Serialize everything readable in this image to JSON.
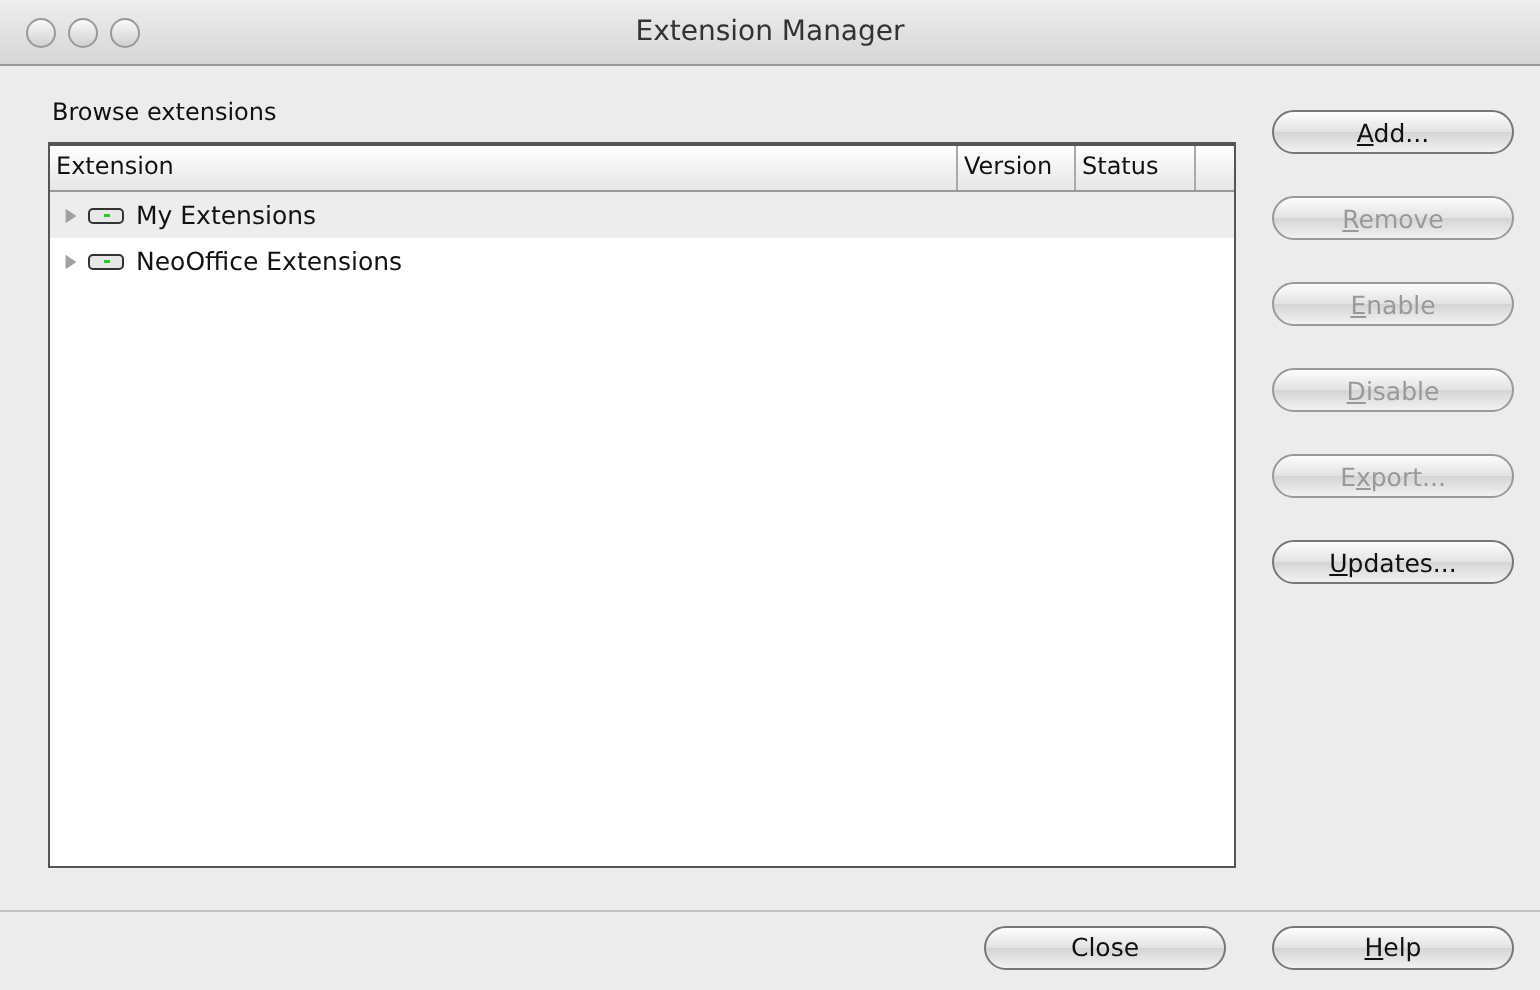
{
  "window": {
    "title": "Extension Manager"
  },
  "section_label": "Browse extensions",
  "table": {
    "columns": [
      "Extension",
      "Version",
      "Status"
    ],
    "rows": [
      {
        "name": "My Extensions",
        "expanded": false
      },
      {
        "name": "NeoOffice Extensions",
        "expanded": false
      }
    ]
  },
  "side_buttons": [
    {
      "label": [
        {
          "text": "A",
          "underline": true
        },
        {
          "text": "dd...",
          "underline": false
        }
      ],
      "disabled": false
    },
    {
      "label": [
        {
          "text": "R",
          "underline": true
        },
        {
          "text": "emove",
          "underline": false
        }
      ],
      "disabled": true
    },
    {
      "label": [
        {
          "text": "E",
          "underline": true
        },
        {
          "text": "nable",
          "underline": false
        }
      ],
      "disabled": true
    },
    {
      "label": [
        {
          "text": "D",
          "underline": true
        },
        {
          "text": "isable",
          "underline": false
        }
      ],
      "disabled": true
    },
    {
      "label": [
        {
          "text": "E",
          "underline": false
        },
        {
          "text": "x",
          "underline": true
        },
        {
          "text": "port...",
          "underline": false
        }
      ],
      "disabled": true
    },
    {
      "label": [
        {
          "text": "U",
          "underline": true
        },
        {
          "text": "pdates...",
          "underline": false
        }
      ],
      "disabled": false
    }
  ],
  "footer_buttons": [
    {
      "label": [
        {
          "text": "Close",
          "underline": false
        }
      ],
      "disabled": false
    },
    {
      "label": [
        {
          "text": "H",
          "underline": true
        },
        {
          "text": "elp",
          "underline": false
        }
      ],
      "disabled": false
    }
  ]
}
